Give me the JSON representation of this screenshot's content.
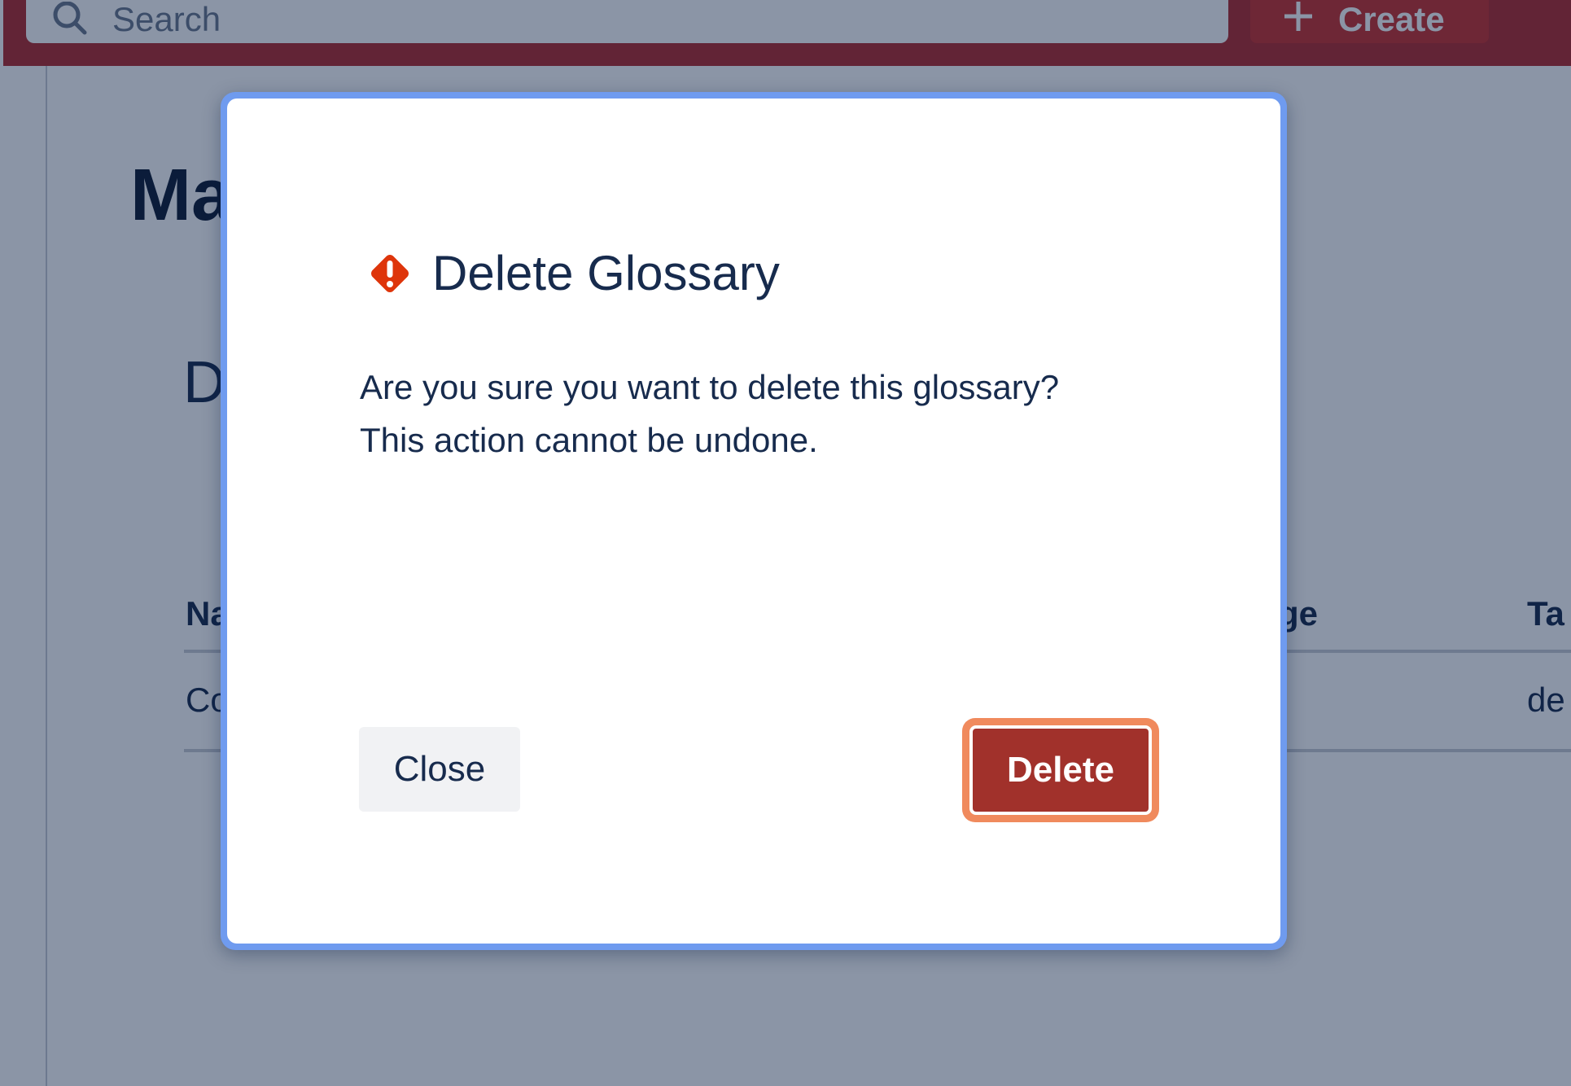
{
  "header": {
    "search": {
      "placeholder": "Search",
      "icon": "search-icon"
    },
    "create_button": {
      "label": "Create",
      "icon": "plus-icon"
    }
  },
  "page": {
    "title": "Ma",
    "section_title": "D",
    "table": {
      "columns": [
        "Na",
        "ge",
        "Ta"
      ],
      "rows": [
        [
          "Co",
          "",
          "de"
        ]
      ]
    }
  },
  "modal": {
    "title": "Delete Glossary",
    "icon": "warning-icon",
    "body": [
      "Are you sure you want to delete this glossary?",
      "This action cannot be undone."
    ],
    "close_label": "Close",
    "delete_label": "Delete"
  },
  "colors": {
    "brand_red": "#b22a2c",
    "danger": "#a1312b",
    "focus_ring": "#6f9bef",
    "button_focus_ring": "#f08a5d",
    "warning_icon": "#de350b"
  }
}
